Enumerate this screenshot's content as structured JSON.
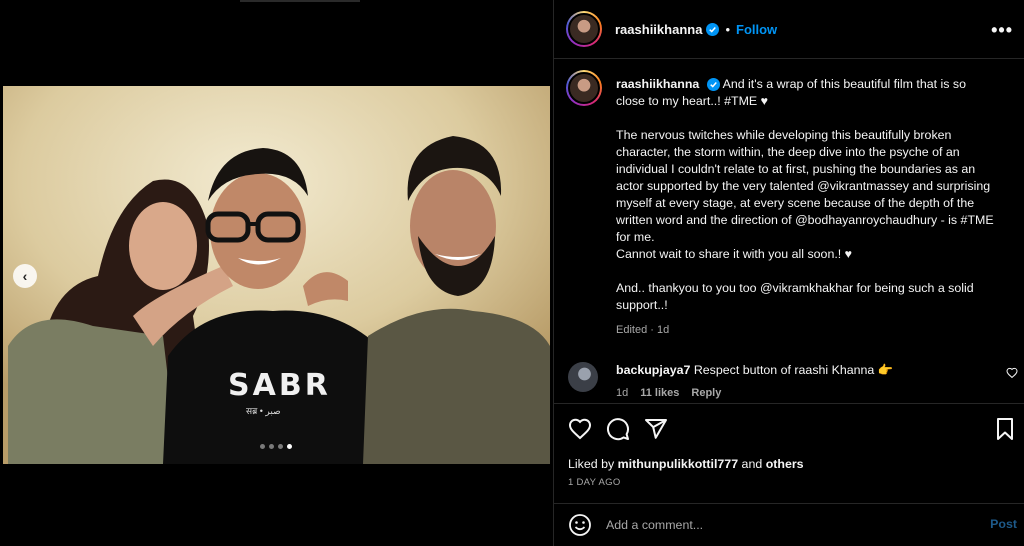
{
  "colors": {
    "accent": "#0095f6",
    "muted": "#a8a8a8",
    "background": "#000000"
  },
  "media": {
    "shirt_text": "SABR",
    "shirt_subtext": "सब्र • صبر",
    "carousel_prev_icon": "chevron-left-icon",
    "carousel_count": 4,
    "carousel_active_index": 4
  },
  "header": {
    "username": "raashiikhanna",
    "verified_icon": "verified-badge-icon",
    "separator": "•",
    "follow_label": "Follow",
    "more_icon": "more-options-icon",
    "more_label": "•••"
  },
  "caption": {
    "username": "raashiikhanna",
    "paragraph1": "And it's a wrap of this beautiful film that is so close to my heart..! #TME ♥",
    "paragraph2": "The nervous twitches while developing this beautifully broken character, the storm within, the deep dive into the psyche of an individual I couldn't relate to at first, pushing the boundaries as an actor supported by the very talented @vikrantmassey and surprising myself at every stage, at every scene because of the depth of the written word and the direction of @bodhayanroychaudhury - is #TME for me.",
    "paragraph2b": "Cannot wait to share it with you all soon.! ♥",
    "paragraph3": "And.. thankyou to you too @vikramkhakhar for being such a solid support..!",
    "meta": "Edited · 1d"
  },
  "comment": {
    "username": "backupjaya7",
    "text": "Respect button of raashi Khanna 👉",
    "time": "1d",
    "likes": "11 likes",
    "reply_label": "Reply",
    "heart_icon": "heart-outline-icon"
  },
  "actions": {
    "like_icon": "heart-outline-icon",
    "comment_icon": "comment-icon",
    "share_icon": "share-paper-plane-icon",
    "save_icon": "bookmark-icon",
    "liked_by_prefix": "Liked by",
    "liked_by_user": "mithunpulikkottil777",
    "liked_by_and": "and",
    "liked_by_others": "others",
    "date": "1 DAY AGO"
  },
  "add_comment": {
    "emoji_icon": "emoji-smiley-icon",
    "placeholder": "Add a comment...",
    "post_label": "Post"
  }
}
